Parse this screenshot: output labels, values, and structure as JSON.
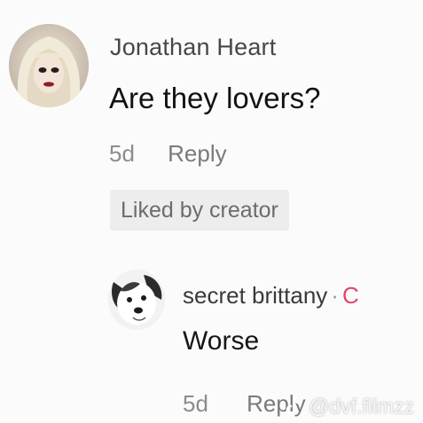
{
  "comment": {
    "author": "Jonathan Heart",
    "text": "Are they lovers?",
    "time": "5d",
    "reply_label": "Reply",
    "liked_badge": "Liked by creator",
    "avatar_icon": "user-avatar"
  },
  "reply": {
    "author": "secret brittany",
    "separator": "·",
    "creator_tag": "C",
    "text": "Worse",
    "time": "5d",
    "reply_label": "Reply",
    "avatar_icon": "dog-avatar"
  },
  "watermark": {
    "text": "@dvf.filmzz",
    "icon": "tiktok-logo-icon"
  },
  "colors": {
    "background": "#fbfbfb",
    "author": "#474747",
    "body_text": "#121212",
    "meta": "#8c8c8c",
    "badge_bg": "#ededed",
    "creator_tag": "#e0466b"
  }
}
